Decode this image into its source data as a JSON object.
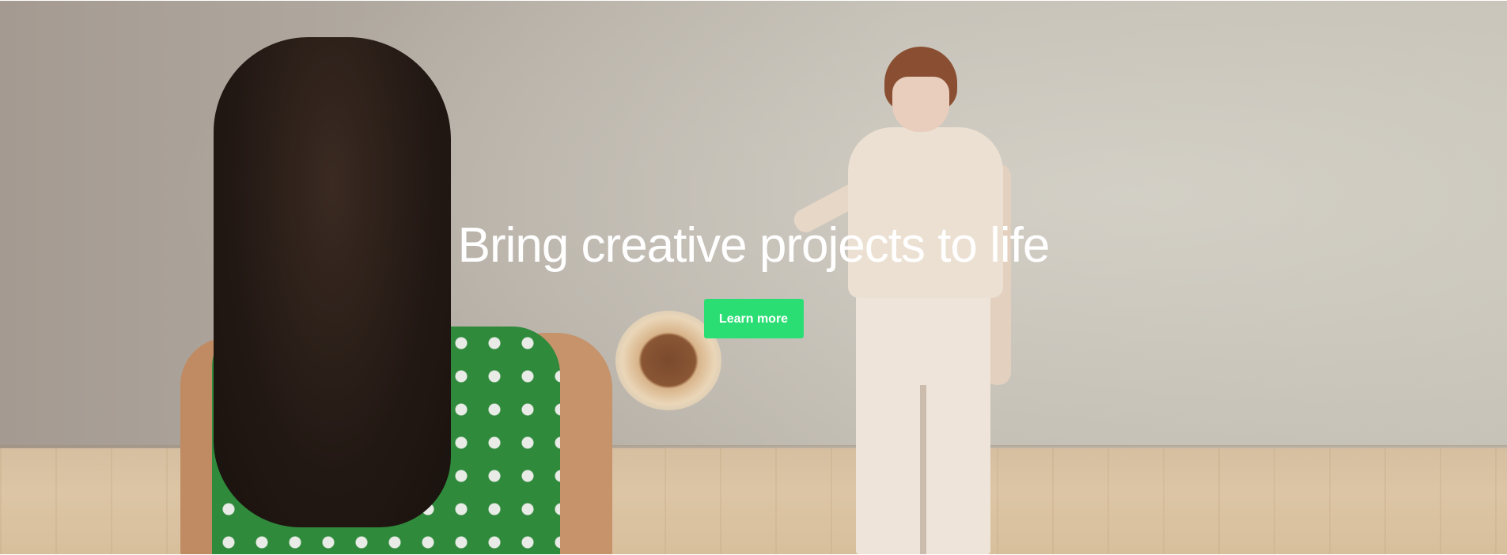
{
  "hero": {
    "title": "Bring creative projects to life",
    "cta_label": "Learn more",
    "cta_color": "#2bde73",
    "title_color": "#ffffff"
  },
  "background": {
    "icon": "hero-photo-two-dancers"
  }
}
